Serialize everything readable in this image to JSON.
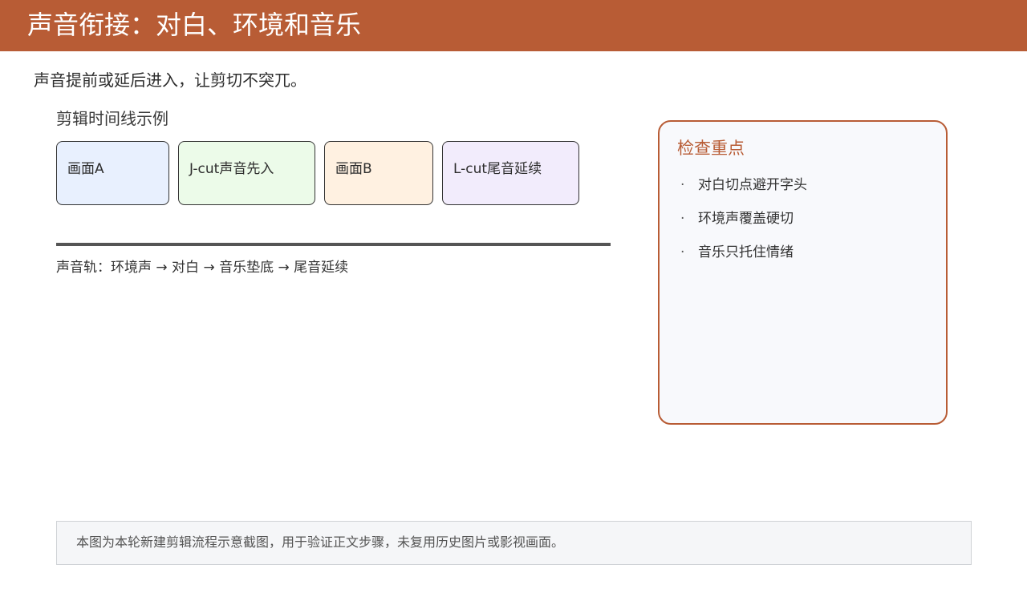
{
  "header": {
    "title": "声音衔接：对白、环境和音乐"
  },
  "subtitle": "声音提前或延后进入，让剪切不突兀。",
  "timeline": {
    "heading": "剪辑时间线示例",
    "clips": [
      {
        "label": "画面A",
        "color": "#e8f0fe"
      },
      {
        "label": "J-cut声音先入",
        "color": "#ecfbe9"
      },
      {
        "label": "画面B",
        "color": "#fff1e1"
      },
      {
        "label": "L-cut尾音延续",
        "color": "#f2ecfc"
      }
    ],
    "track_caption": "声音轨：环境声 → 对白 → 音乐垫底 → 尾音延续"
  },
  "panel": {
    "title": "检查重点",
    "bullet_glyph": "·",
    "items": [
      "对白切点避开字头",
      "环境声覆盖硬切",
      "音乐只托住情绪"
    ]
  },
  "footer": {
    "note": "本图为本轮新建剪辑流程示意截图，用于验证正文步骤，未复用历史图片或影视画面。"
  },
  "colors": {
    "accent": "#b85c35",
    "track_line": "#555555",
    "panel_bg": "#f8f9fc"
  }
}
